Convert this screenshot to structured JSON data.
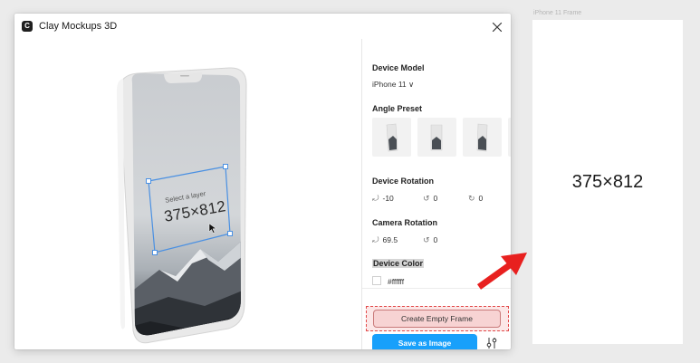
{
  "plugin": {
    "logo": "C",
    "title": "Clay Mockups 3D",
    "close_icon": "close-icon"
  },
  "preview": {
    "hint": "Select a layer",
    "size_text": "375×812"
  },
  "settings": {
    "device_model": {
      "label": "Device Model",
      "value": "iPhone 11 ∨"
    },
    "angle_preset": {
      "label": "Angle Preset",
      "presets": [
        "preset-1",
        "preset-2",
        "preset-3",
        "preset-4"
      ]
    },
    "device_rotation": {
      "label": "Device Rotation",
      "x": "-10",
      "y": "0",
      "z": "0"
    },
    "camera_rotation": {
      "label": "Camera Rotation",
      "x": "69.5",
      "y": "0"
    },
    "device_color": {
      "label": "Device Color",
      "value": "#ffffff"
    }
  },
  "actions": {
    "create_empty_frame": "Create Empty Frame",
    "save_as_image": "Save as Image"
  },
  "canvas": {
    "frame_label": "iPhone 11 Frame",
    "frame_text": "375×812"
  },
  "colors": {
    "accent": "#18a0fb",
    "selection": "#4a90e2",
    "highlight_border": "#e24a4a",
    "arrow": "#e8201f"
  }
}
